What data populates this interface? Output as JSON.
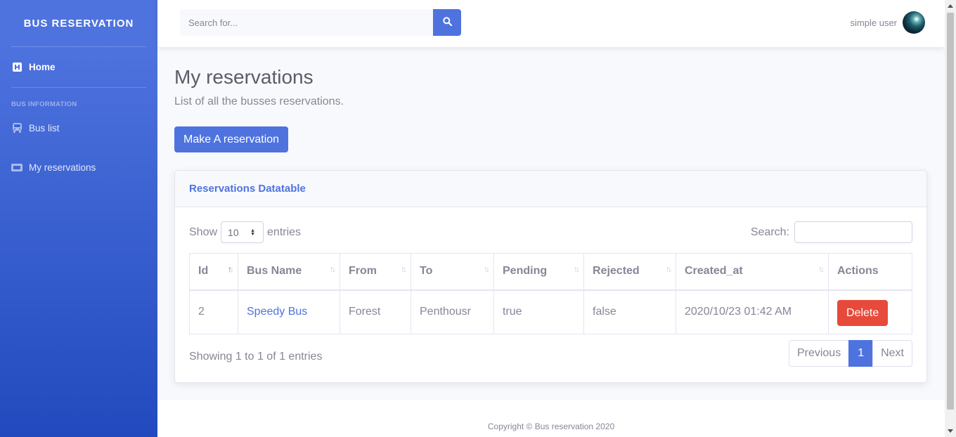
{
  "sidebar": {
    "brand": "BUS RESERVATION",
    "home_label": "Home",
    "section_heading": "BUS INFORMATION",
    "items": [
      {
        "label": "Bus list",
        "icon": "bus-icon"
      },
      {
        "label": "My reservations",
        "icon": "ticket-icon"
      }
    ]
  },
  "topbar": {
    "search_placeholder": "Search for...",
    "user_name": "simple user"
  },
  "page": {
    "title": "My reservations",
    "description": "List of all the busses reservations.",
    "primary_button": "Make A reservation"
  },
  "card": {
    "title": "Reservations Datatable",
    "show_label": "Show",
    "entries_value": "10",
    "entries_label": "entries",
    "search_label": "Search:",
    "columns": [
      "Id",
      "Bus Name",
      "From",
      "To",
      "Pending",
      "Rejected",
      "Created_at",
      "Actions"
    ],
    "rows": [
      {
        "id": "2",
        "bus_name": "Speedy Bus",
        "from": "Forest",
        "to": "Penthousr",
        "pending": "true",
        "rejected": "false",
        "created_at": "2020/10/23 01:42 AM",
        "action": "Delete"
      }
    ],
    "info": "Showing 1 to 1 of 1 entries",
    "pagination": {
      "previous": "Previous",
      "current": "1",
      "next": "Next"
    }
  },
  "footer": {
    "copyright": "Copyright © Bus reservation 2020"
  },
  "colors": {
    "primary": "#4e73df",
    "danger": "#e74a3b",
    "sidebar_end": "#224abe"
  }
}
